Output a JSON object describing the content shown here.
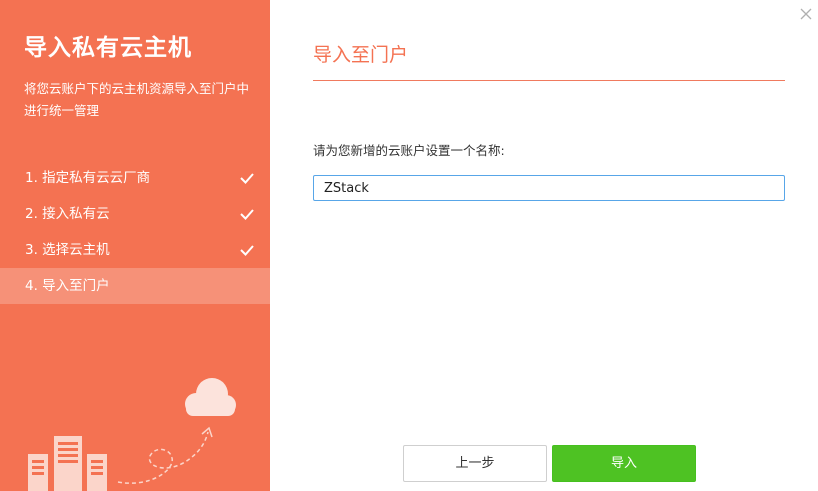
{
  "sidebar": {
    "title": "导入私有云主机",
    "description": "将您云账户下的云主机资源导入至门户中进行统一管理",
    "steps": [
      {
        "label": "1. 指定私有云云厂商",
        "done": true
      },
      {
        "label": "2. 接入私有云",
        "done": true
      },
      {
        "label": "3. 选择云主机",
        "done": true
      },
      {
        "label": "4. 导入至门户",
        "done": false,
        "active": true
      }
    ],
    "check_icon": "check-icon",
    "illustration_icons": [
      "server-icon",
      "cloud-icon",
      "arrow-icon"
    ]
  },
  "main": {
    "title": "导入至门户",
    "field_label": "请为您新增的云账户设置一个名称:",
    "field_value": "ZStack",
    "close_icon": "close-icon"
  },
  "buttons": {
    "prev_label": "上一步",
    "import_label": "导入"
  },
  "colors": {
    "sidebar_bg": "#f47252",
    "accent": "#f47252",
    "primary_button": "#4ec223",
    "input_border": "#58a6e8"
  }
}
